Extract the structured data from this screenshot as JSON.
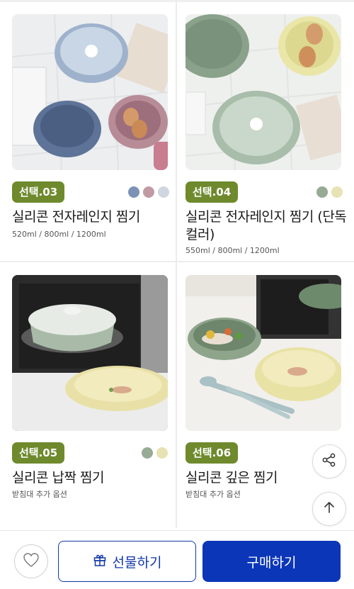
{
  "products": [
    {
      "badge": "선택.03",
      "title": "실리콘 전자레인지 찜기",
      "subtitle": "520ml / 800ml / 1200ml",
      "colors": [
        "#7d93b6",
        "#c09aa6",
        "#cfd6e2"
      ]
    },
    {
      "badge": "선택.04",
      "title": "실리콘 전자레인지 찜기 (단독컬러)",
      "subtitle": "550ml / 800ml / 1200ml",
      "colors": [
        "#97aa94",
        "#e6e3b4"
      ]
    },
    {
      "badge": "선택.05",
      "title": "실리콘 납짝 찜기",
      "subtitle": "받침대 추가 옵션",
      "colors": [
        "#98ab95",
        "#e6e2b2"
      ]
    },
    {
      "badge": "선택.06",
      "title": "실리콘 깊은 찜기",
      "subtitle": "받침대 추가 옵션",
      "colors": []
    }
  ],
  "floating": {
    "share_icon": "share-icon",
    "top_icon": "arrow-up-icon"
  },
  "bottom_bar": {
    "wishlist_icon": "heart-icon",
    "gift_label": "선물하기",
    "gift_icon": "gift-icon",
    "buy_label": "구매하기"
  },
  "theme": {
    "badge_color": "#6e8a2d",
    "primary": "#0b36b8"
  }
}
